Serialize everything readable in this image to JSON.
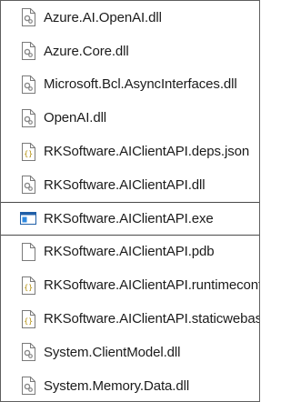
{
  "files": [
    {
      "name": "Azure.AI.OpenAI.dll",
      "icon": "dll-file-icon",
      "selected": false
    },
    {
      "name": "Azure.Core.dll",
      "icon": "dll-file-icon",
      "selected": false
    },
    {
      "name": "Microsoft.Bcl.AsyncInterfaces.dll",
      "icon": "dll-file-icon",
      "selected": false
    },
    {
      "name": "OpenAI.dll",
      "icon": "dll-file-icon",
      "selected": false
    },
    {
      "name": "RKSoftware.AIClientAPI.deps.json",
      "icon": "json-file-icon",
      "selected": false
    },
    {
      "name": "RKSoftware.AIClientAPI.dll",
      "icon": "dll-file-icon",
      "selected": false
    },
    {
      "name": "RKSoftware.AIClientAPI.exe",
      "icon": "exe-file-icon",
      "selected": true
    },
    {
      "name": "RKSoftware.AIClientAPI.pdb",
      "icon": "blank-file-icon",
      "selected": false
    },
    {
      "name": "RKSoftware.AIClientAPI.runtimeconfig.json",
      "icon": "json-file-icon",
      "selected": false
    },
    {
      "name": "RKSoftware.AIClientAPI.staticwebassets.endpoints.json",
      "icon": "json-file-icon",
      "selected": false
    },
    {
      "name": "System.ClientModel.dll",
      "icon": "dll-file-icon",
      "selected": false
    },
    {
      "name": "System.Memory.Data.dll",
      "icon": "dll-file-icon",
      "selected": false
    }
  ]
}
